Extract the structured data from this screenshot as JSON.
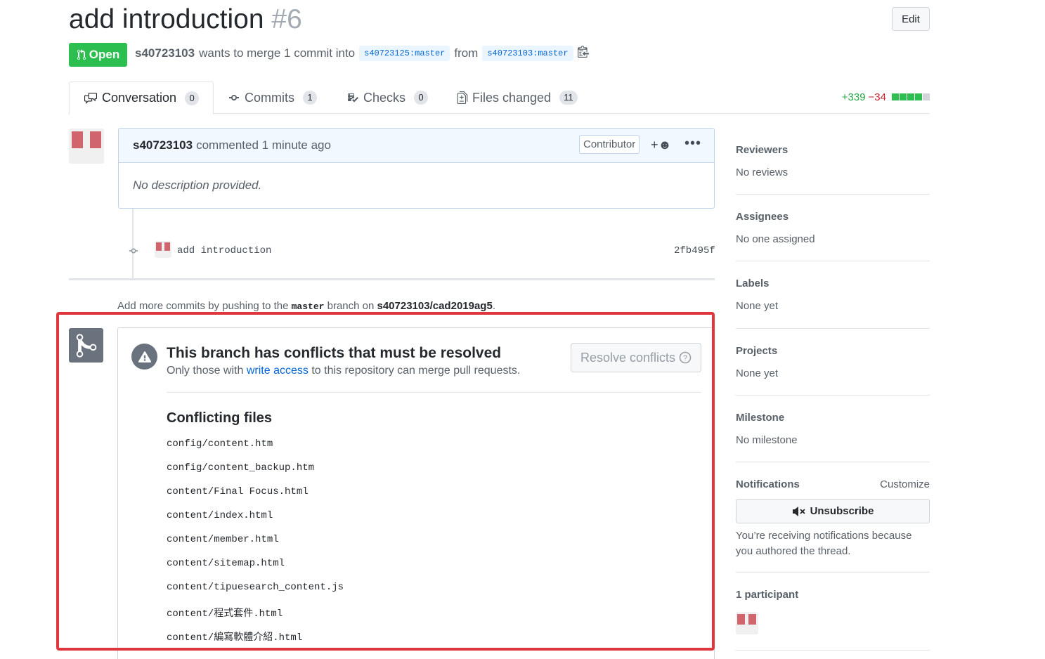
{
  "header": {
    "title": "add introduction",
    "number": "#6",
    "edit_label": "Edit",
    "state_label": "Open",
    "author": "s40723103",
    "merge_text": "wants to merge 1 commit into",
    "base_branch": "s40723125:master",
    "from_text": "from",
    "head_branch": "s40723103:master"
  },
  "tabs": [
    {
      "label": "Conversation",
      "count": "0"
    },
    {
      "label": "Commits",
      "count": "1"
    },
    {
      "label": "Checks",
      "count": "0"
    },
    {
      "label": "Files changed",
      "count": "11"
    }
  ],
  "diffstat": {
    "additions": "+339",
    "deletions": "−34"
  },
  "comment": {
    "author": "s40723103",
    "action": "commented",
    "time": "1 minute ago",
    "role": "Contributor",
    "body": "No description provided."
  },
  "commit": {
    "message": "add introduction",
    "sha": "2fb495f"
  },
  "push_note": {
    "prefix": "Add more commits by pushing to the",
    "branch": "master",
    "middle": "branch on",
    "repo": "s40723103/cad2019ag5",
    "suffix": "."
  },
  "merge": {
    "title": "This branch has conflicts that must be resolved",
    "sub_prefix": "Only those with",
    "sub_link": "write access",
    "sub_suffix": "to this repository can merge pull requests.",
    "resolve_label": "Resolve conflicts",
    "conflicts_title": "Conflicting files",
    "files": [
      "config/content.htm",
      "config/content_backup.htm",
      "content/Final Focus.html",
      "content/index.html",
      "content/member.html",
      "content/sitemap.html",
      "content/tipuesearch_content.js",
      "content/程式套件.html",
      "content/編寫軟體介紹.html"
    ]
  },
  "sidebar": {
    "reviewers": {
      "heading": "Reviewers",
      "value": "No reviews"
    },
    "assignees": {
      "heading": "Assignees",
      "value": "No one assigned"
    },
    "labels": {
      "heading": "Labels",
      "value": "None yet"
    },
    "projects": {
      "heading": "Projects",
      "value": "None yet"
    },
    "milestone": {
      "heading": "Milestone",
      "value": "No milestone"
    },
    "notifications": {
      "heading": "Notifications",
      "customize": "Customize",
      "button": "Unsubscribe",
      "note": "You’re receiving notifications because you authored the thread."
    },
    "participants": {
      "heading": "1 participant"
    }
  },
  "colors": {
    "open_green": "#2cbe4e",
    "link_blue": "#0366d6",
    "highlight_red": "#e0363d",
    "avatar_red": "#d0656e"
  }
}
